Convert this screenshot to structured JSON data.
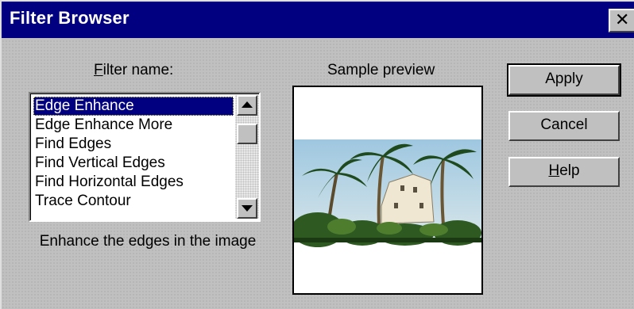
{
  "window": {
    "title": "Filter Browser",
    "close_glyph": "✕"
  },
  "filter_name_label": "Filter name:",
  "filter_name_mnemonic": "F",
  "filter_name_rest": "ilter name:",
  "filters": [
    {
      "label": "Edge Enhance",
      "selected": true
    },
    {
      "label": "Edge Enhance More",
      "selected": false
    },
    {
      "label": "Find Edges",
      "selected": false
    },
    {
      "label": "Find Vertical Edges",
      "selected": false
    },
    {
      "label": "Find Horizontal Edges",
      "selected": false
    },
    {
      "label": "Trace Contour",
      "selected": false
    }
  ],
  "description": "Enhance the edges in the image",
  "preview_label": "Sample preview",
  "buttons": {
    "apply": "Apply",
    "cancel": "Cancel",
    "help_mnemonic": "H",
    "help_rest": "elp"
  },
  "scrollbar": {
    "up_icon": "scroll-up-arrow",
    "down_icon": "scroll-down-arrow"
  },
  "colors": {
    "titlebar": "#000080",
    "face": "#c0c0c0",
    "selection": "#000080"
  }
}
